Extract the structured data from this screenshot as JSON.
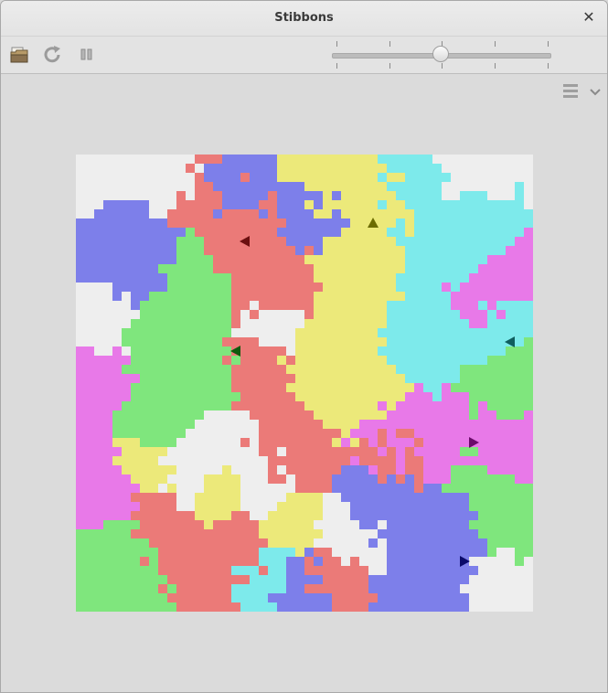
{
  "window": {
    "title": "Stibbons"
  },
  "toolbar": {
    "open_icon": "open-folder-icon",
    "restart_icon": "restart-icon",
    "pause_icon": "pause-icon",
    "menu_icon": "hamburger-menu-icon",
    "dropdown_icon": "chevron-down-icon",
    "speed_slider": {
      "value": 0.5,
      "ticks": 6
    }
  },
  "colors": {
    "background": "#eeeeee",
    "red": "#eb7a78",
    "yellow": "#ece97a",
    "cyan": "#7deaeb",
    "blue": "#7d7fea",
    "green": "#7fe67d",
    "magenta": "#e879e8",
    "turtle_yellow": "#6b6b00",
    "turtle_red": "#6b1010",
    "turtle_green": "#0e5a0e",
    "turtle_cyan": "#0f5e5e",
    "turtle_magenta": "#6b0b6b",
    "turtle_blue": "#0b0b6b"
  },
  "world": {
    "grid_size": 50,
    "turtles": [
      {
        "id": "yellow",
        "x": 32,
        "y": 7,
        "heading": "up"
      },
      {
        "id": "red",
        "x": 18,
        "y": 9,
        "heading": "left"
      },
      {
        "id": "green",
        "x": 17,
        "y": 21,
        "heading": "left"
      },
      {
        "id": "cyan",
        "x": 47,
        "y": 20,
        "heading": "left"
      },
      {
        "id": "magenta",
        "x": 43,
        "y": 31,
        "heading": "right"
      },
      {
        "id": "blue",
        "x": 42,
        "y": 44,
        "heading": "right"
      }
    ]
  }
}
